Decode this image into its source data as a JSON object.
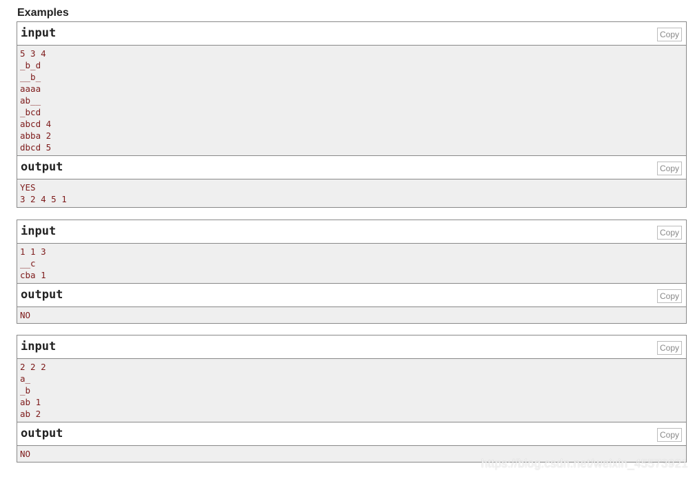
{
  "section_title": "Examples",
  "copy_label": "Copy",
  "tests": [
    {
      "input_title": "input",
      "input_lines": [
        "5 3 4",
        "_b_d",
        "__b_",
        "aaaa",
        "ab__",
        "_bcd",
        "abcd 4",
        "abba 2",
        "dbcd 5"
      ],
      "output_title": "output",
      "output_lines": [
        "YES",
        "3 2 4 5 1"
      ]
    },
    {
      "input_title": "input",
      "input_lines": [
        "1 1 3",
        "__c",
        "cba 1"
      ],
      "output_title": "output",
      "output_lines": [
        "NO"
      ]
    },
    {
      "input_title": "input",
      "input_lines": [
        "2 2 2",
        "a_",
        "_b",
        "ab 1",
        "ab 2"
      ],
      "output_title": "output",
      "output_lines": [
        "NO"
      ]
    }
  ],
  "watermark": "https://blog.csdn.net/weixin_45573921"
}
